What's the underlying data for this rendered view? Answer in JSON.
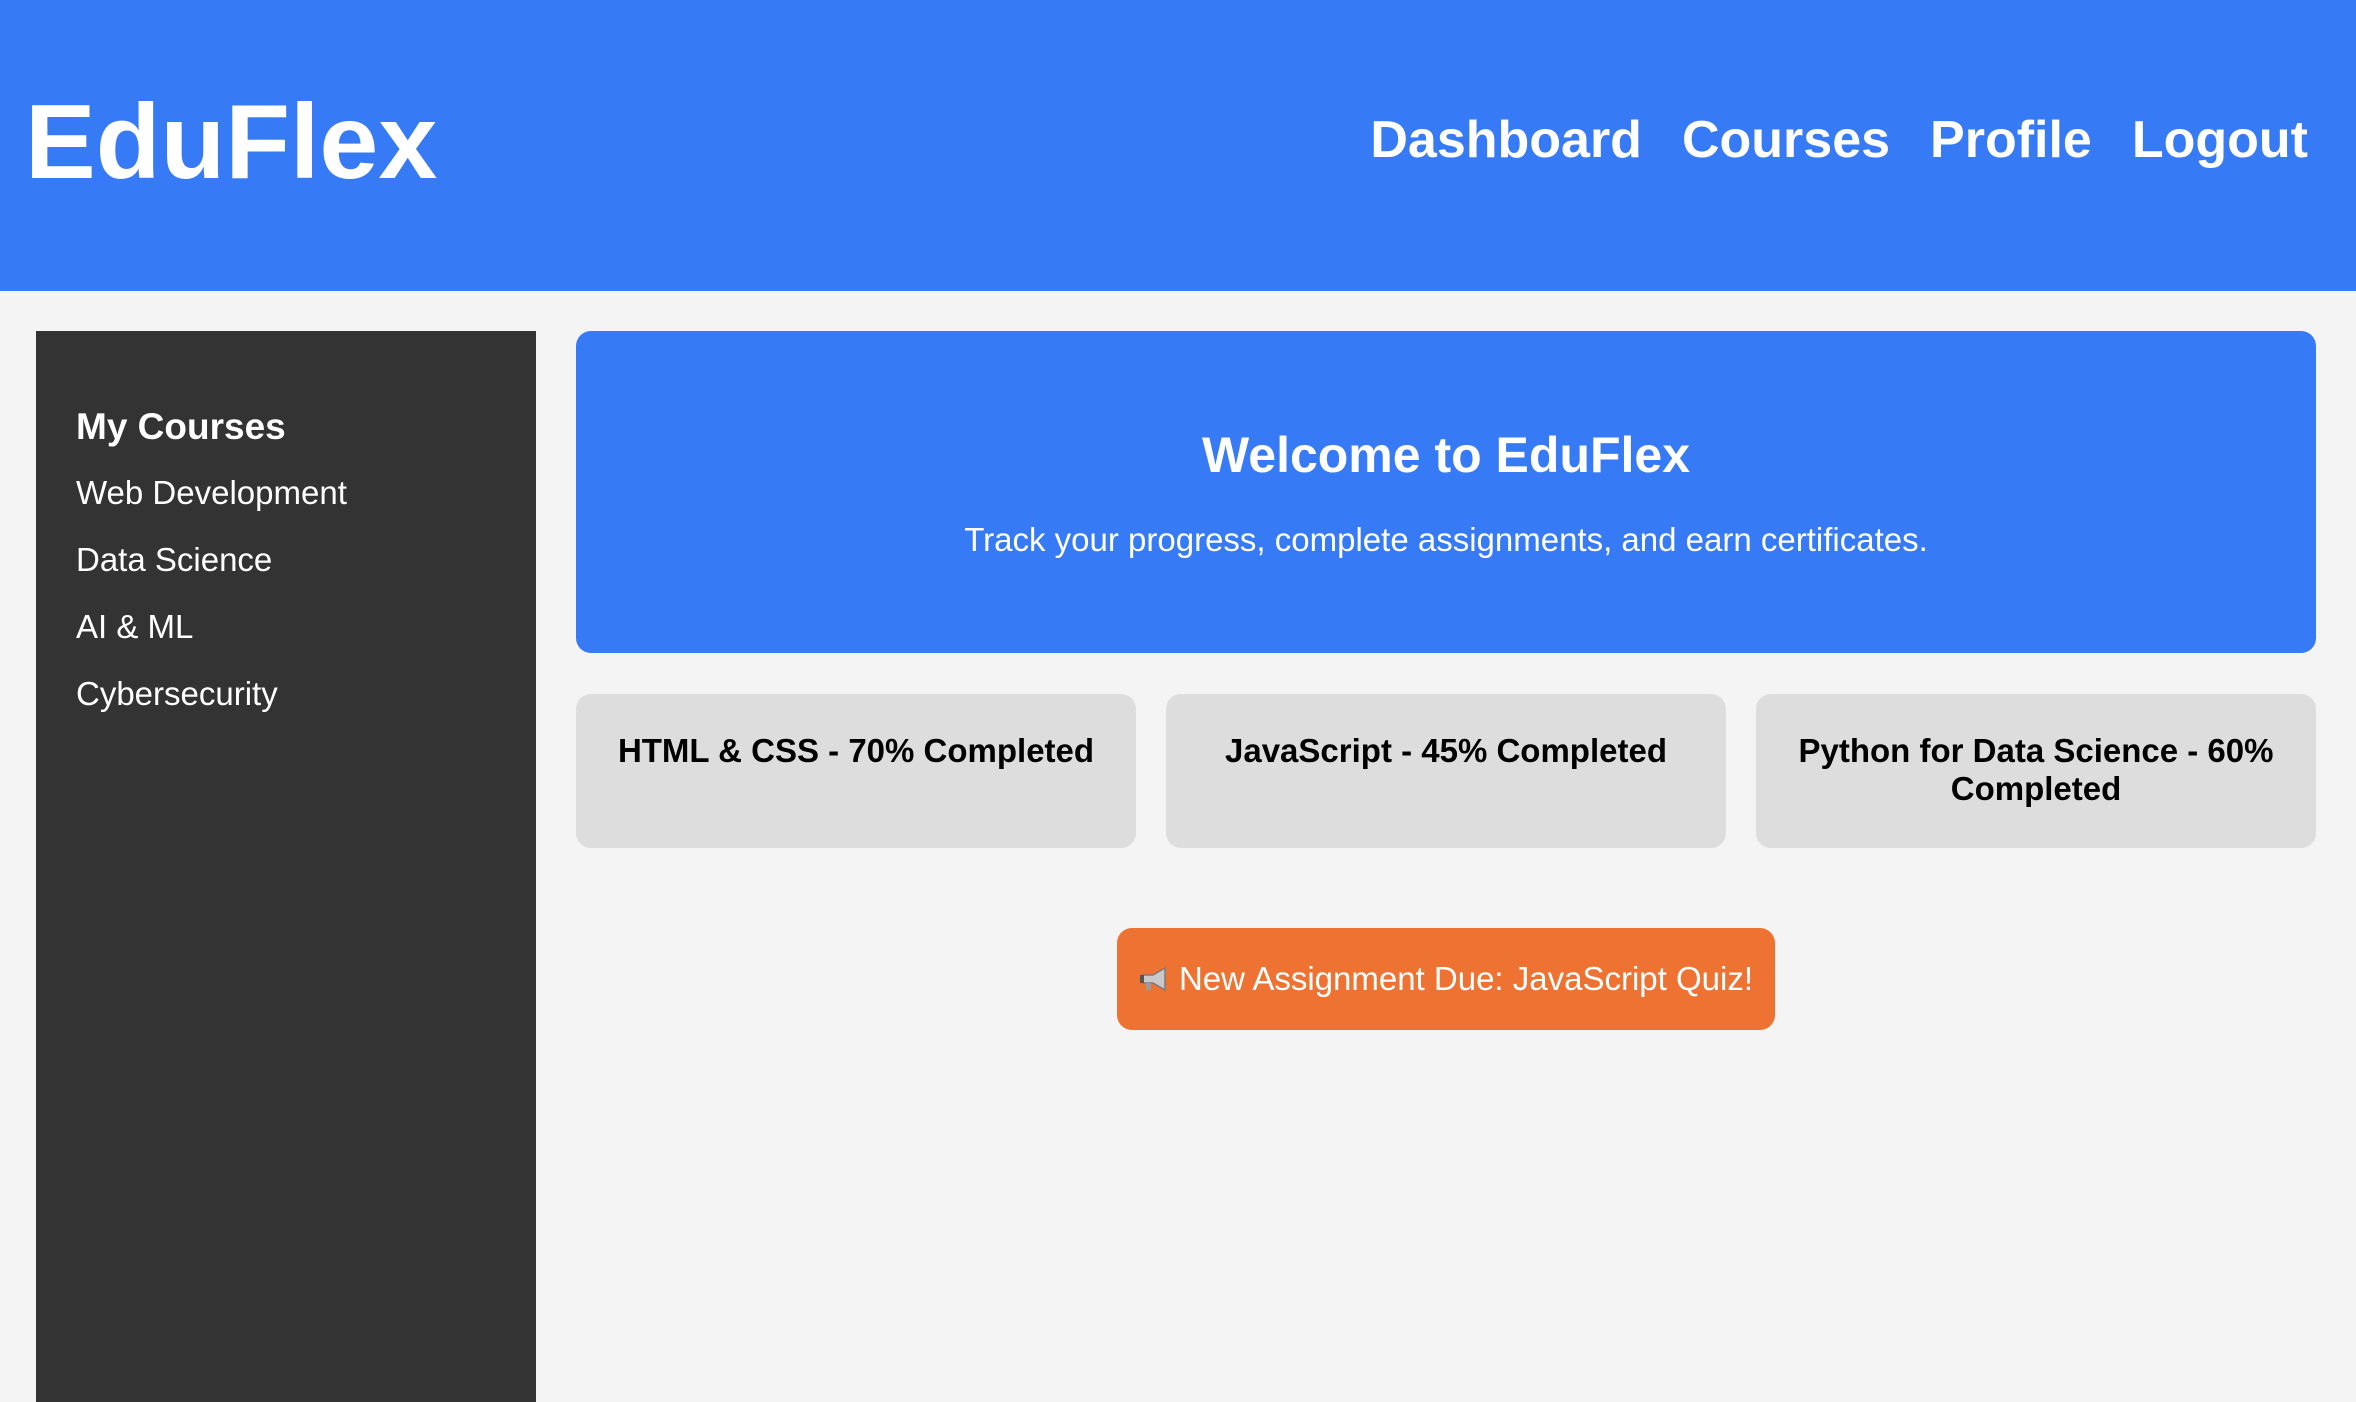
{
  "header": {
    "brand": "EduFlex",
    "nav": [
      "Dashboard",
      "Courses",
      "Profile",
      "Logout"
    ]
  },
  "sidebar": {
    "title": "My Courses",
    "items": [
      "Web Development",
      "Data Science",
      "AI & ML",
      "Cybersecurity"
    ]
  },
  "hero": {
    "title": "Welcome to EduFlex",
    "subtitle": "Track your progress, complete assignments, and earn certificates."
  },
  "courses": [
    {
      "label": "HTML & CSS - 70% Completed",
      "progress": 70
    },
    {
      "label": "JavaScript - 45% Completed",
      "progress": 45
    },
    {
      "label": "Python for Data Science - 60% Completed",
      "progress": 60
    }
  ],
  "alert": {
    "icon": "megaphone-icon",
    "text": "New Assignment Due: JavaScript Quiz!"
  },
  "colors": {
    "primary": "#377af5",
    "sidebar": "#333333",
    "card": "#dddddd",
    "alert": "#ee7332",
    "background": "#f4f4f4"
  }
}
